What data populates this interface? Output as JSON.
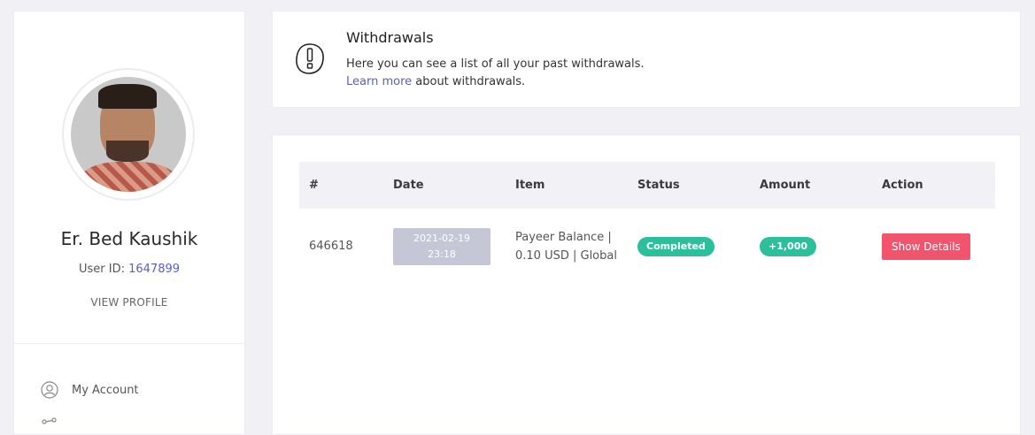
{
  "profile": {
    "name": "Er. Bed Kaushik",
    "user_id_label": "User ID:",
    "user_id": "1647899",
    "view_profile": "VIEW PROFILE"
  },
  "nav": {
    "items": [
      {
        "label": "My Account",
        "icon": "user-icon"
      },
      {
        "label": "",
        "icon": "share-icon"
      }
    ]
  },
  "info": {
    "icon": "exclamation-badge-icon",
    "title": "Withdrawals",
    "description": "Here you can see a list of all your past withdrawals.",
    "learn_more": "Learn more",
    "learn_more_suffix": " about withdrawals."
  },
  "table": {
    "headers": [
      "#",
      "Date",
      "Item",
      "Status",
      "Amount",
      "Action"
    ],
    "rows": [
      {
        "id": "646618",
        "date": "2021-02-19",
        "time": "23:18",
        "item": "Payeer Balance | 0.10 USD | Global",
        "status": "Completed",
        "amount": "+1,000",
        "action": "Show Details"
      }
    ]
  },
  "colors": {
    "accent_link": "#5560c9",
    "status_completed": "#2bbf9e",
    "action_button": "#f2536d",
    "date_badge": "#c5c7d6"
  }
}
